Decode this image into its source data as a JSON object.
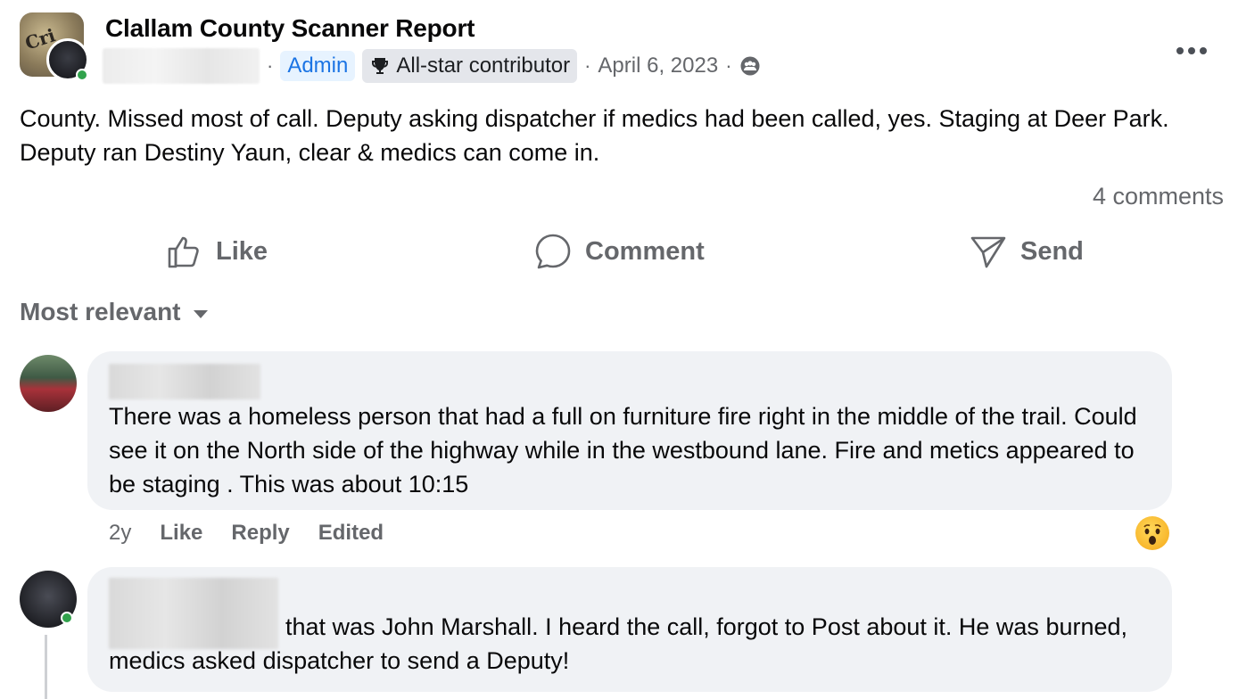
{
  "post": {
    "group_name": "Clallam County Scanner Report",
    "admin_label": "Admin",
    "contributor_label": "All-star contributor",
    "date": "April 6, 2023",
    "separator": "·",
    "text": "County. Missed most of call. Deputy asking dispatcher if medics had been called, yes. Staging at Deer Park. Deputy ran Destiny Yaun, clear & medics can come in.",
    "comments_count": "4 comments",
    "more_icon": "more-dots-icon",
    "audience_icon": "group-audience-icon"
  },
  "actions": {
    "like": "Like",
    "comment": "Comment",
    "send": "Send"
  },
  "sort": {
    "label": "Most relevant"
  },
  "comments": [
    {
      "text": "There was a homeless person that had a full on furniture fire right in the middle of the trail. Could see it on the North side of the highway while in the westbound lane. Fire and metics appeared to be staging . This was about 10:15",
      "age": "2y",
      "like": "Like",
      "reply": "Reply",
      "edited": "Edited",
      "reaction_icon": "wow-reaction-icon"
    },
    {
      "text": "that was John Marshall. I heard the call, forgot to Post about it. He was burned, medics asked dispatcher to send a Deputy!"
    }
  ],
  "colors": {
    "accent": "#1b74e4",
    "muted": "#65676b",
    "bubble": "#f0f2f5",
    "online": "#31a24c"
  }
}
